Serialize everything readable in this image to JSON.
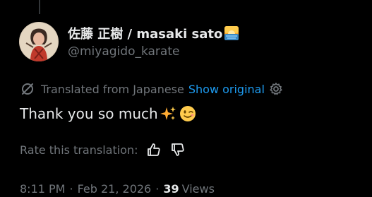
{
  "author": {
    "display_name": "佐藤 正樹 / masaki sato",
    "name_emoji": "sunrise-over-sea-emoji",
    "handle": "@miyagido_karate",
    "avatar": "avatar-illustration"
  },
  "translation": {
    "icon": "translate-off-icon",
    "notice": "Translated from Japanese",
    "show_original_label": "Show original",
    "settings_icon": "gear-icon"
  },
  "tweet": {
    "text": "Thank you so much",
    "emojis": [
      "sparkles-emoji",
      "winking-face-emoji"
    ]
  },
  "rating": {
    "label": "Rate this translation:",
    "thumbs_up_icon": "thumbs-up-icon",
    "thumbs_down_icon": "thumbs-down-icon"
  },
  "meta": {
    "time": "8:11 PM",
    "separator": "·",
    "date": "Feb 21, 2026",
    "views_count": "39",
    "views_label": "Views"
  },
  "colors": {
    "background": "#000000",
    "primary_text": "#e7e9ea",
    "secondary_text": "#71767b",
    "link": "#1d9bf0",
    "thread_line": "#333639"
  }
}
